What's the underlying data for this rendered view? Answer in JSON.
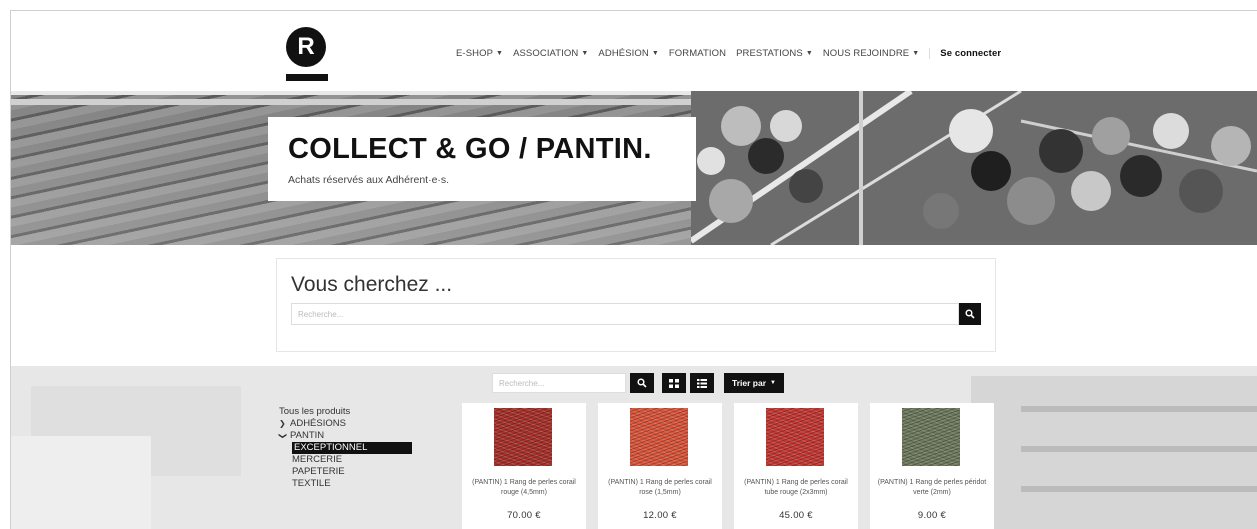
{
  "header": {
    "logo_letter": "R",
    "nav": [
      {
        "label": "E-SHOP",
        "dropdown": true
      },
      {
        "label": "ASSOCIATION",
        "dropdown": true
      },
      {
        "label": "ADHÉSION",
        "dropdown": true
      },
      {
        "label": "FORMATION",
        "dropdown": false
      },
      {
        "label": "PRESTATIONS",
        "dropdown": true
      },
      {
        "label": "NOUS REJOINDRE",
        "dropdown": true
      }
    ],
    "login_label": "Se connecter"
  },
  "banner": {
    "title": "COLLECT & GO / PANTIN.",
    "subtitle": "Achats réservés aux Adhérent·e·s."
  },
  "search_panel": {
    "heading": "Vous cherchez ...",
    "placeholder": "Recherche..."
  },
  "toolbar": {
    "placeholder": "Recherche...",
    "sort_label": "Trier par"
  },
  "categories": {
    "all": "Tous les produits",
    "groups": [
      {
        "label": "ADHÉSIONS",
        "expanded": false
      },
      {
        "label": "PANTIN",
        "expanded": true,
        "children": [
          "EXCEPTIONNEL",
          "MERCERIE",
          "PAPETERIE",
          "TEXTILE"
        ],
        "active_child": "EXCEPTIONNEL"
      }
    ]
  },
  "products": [
    {
      "name": "(PANTIN) 1 Rang de perles corail rouge (4,5mm)",
      "price": "70.00 €",
      "color": "#a8332c"
    },
    {
      "name": "(PANTIN) 1 Rang de perles corail rose (1,5mm)",
      "price": "12.00 €",
      "color": "#d9573d"
    },
    {
      "name": "(PANTIN) 1 Rang de perles corail tube rouge (2x3mm)",
      "price": "45.00 €",
      "color": "#c43a36"
    },
    {
      "name": "(PANTIN) 1 Rang de perles péridot verte (2mm)",
      "price": "9.00 €",
      "color": "#6f7a5e"
    }
  ],
  "colors": {
    "accent": "#111111",
    "background": "#ffffff"
  }
}
